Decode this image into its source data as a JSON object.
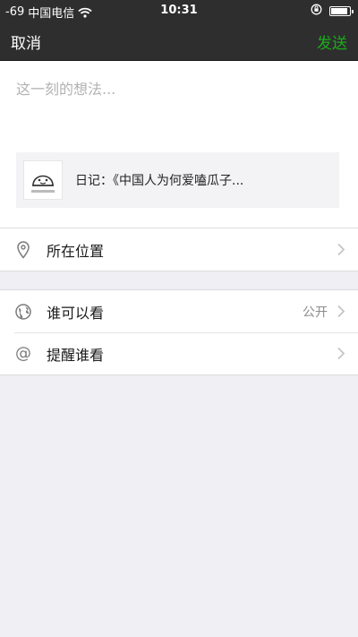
{
  "status_bar": {
    "signal": "-69",
    "carrier": "中国电信",
    "time": "10:31",
    "battery_level": 0.9,
    "icons": [
      "wifi-icon",
      "rotation-lock-icon",
      "battery-icon"
    ]
  },
  "nav": {
    "cancel_label": "取消",
    "send_label": "发送"
  },
  "composer": {
    "placeholder": "这一刻的想法...",
    "value": ""
  },
  "share_card": {
    "title": "日记：《中国人为何爱嗑瓜子...",
    "thumb_icon": "smiley-logo-icon"
  },
  "location": {
    "label": "所在位置",
    "icon": "location-pin-icon"
  },
  "privacy": {
    "visibility_label": "谁可以看",
    "visibility_value": "公开",
    "visibility_icon": "globe-icon",
    "mention_label": "提醒谁看",
    "mention_icon": "at-icon"
  },
  "colors": {
    "nav_bg": "#2e2e2e",
    "send_green": "#1aad19",
    "page_bg": "#efeff4"
  }
}
